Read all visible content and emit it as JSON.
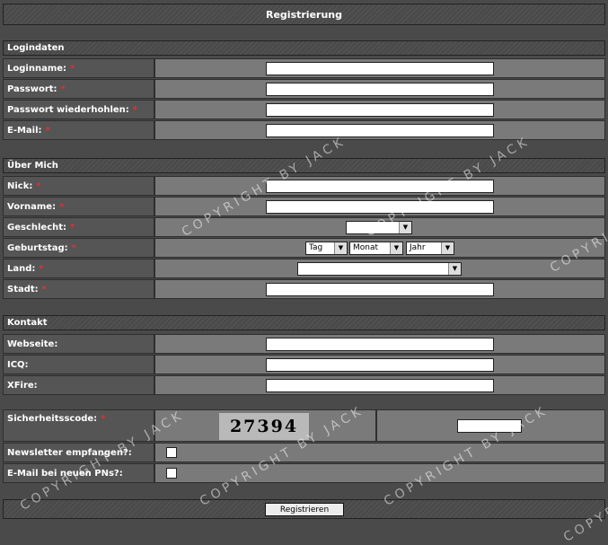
{
  "page": {
    "title": "Registrierung"
  },
  "sections": {
    "login": {
      "title": "Logindaten",
      "fields": {
        "loginname": "Loginname:",
        "passwort": "Passwort:",
        "passwort2": "Passwort wiederhohlen:",
        "email": "E-Mail:"
      }
    },
    "about": {
      "title": "Über Mich",
      "fields": {
        "nick": "Nick:",
        "vorname": "Vorname:",
        "geschlecht": "Geschlecht:",
        "geburtstag": "Geburtstag:",
        "land": "Land:",
        "stadt": "Stadt:"
      },
      "birthday_selects": {
        "day": "Tag",
        "month": "Monat",
        "year": "Jahr"
      }
    },
    "contact": {
      "title": "Kontakt",
      "fields": {
        "webseite": "Webseite:",
        "icq": "ICQ:",
        "xfire": "XFire:"
      }
    }
  },
  "security": {
    "label": "Sicherheitsscode:",
    "captcha_text": "27394"
  },
  "options": {
    "newsletter": "Newsletter empfangen?:",
    "email_pn": "E-Mail bei neuen PNs?:"
  },
  "required_marker": "*",
  "submit_label": "Registrieren",
  "watermark": "COPYRIGHT BY JACK",
  "colors": {
    "required": "#dd3333",
    "label_bg": "#555555",
    "value_bg": "#7a7a7a"
  }
}
